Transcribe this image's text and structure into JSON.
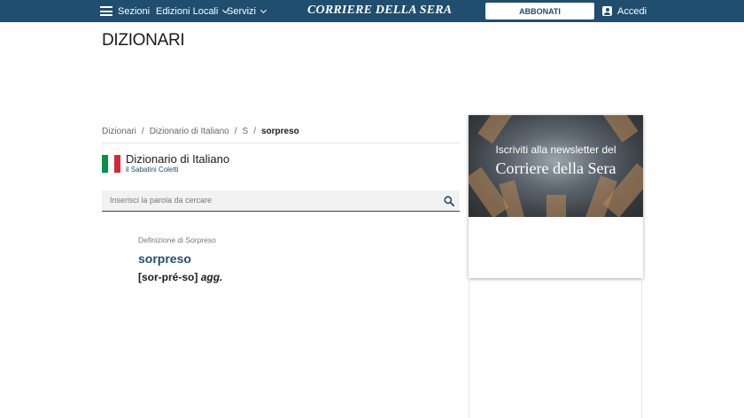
{
  "header": {
    "menu_label": "Sezioni",
    "edizioni_label": "Edizioni Locali",
    "servizi_label": "Servizi",
    "logo_text": "CORRIERE DELLA SERA",
    "abbonati_label": "ABBONATI",
    "accedi_label": "Accedi",
    "bg_color": "#1f4e6e"
  },
  "page": {
    "title": "DIZIONARI"
  },
  "breadcrumb": {
    "items": [
      "Dizionari",
      "Dizionario di Italiano",
      "S"
    ],
    "current": "sorpreso",
    "separator": "/"
  },
  "dictionary": {
    "title": "Dizionario di Italiano",
    "subtitle": "il Sabatini Coletti",
    "flag_colors": [
      "#009246",
      "#ffffff",
      "#ce2b37"
    ]
  },
  "search": {
    "placeholder": "Inserisci la parola da cercare",
    "value": ""
  },
  "definition": {
    "label": "Definizione di Sorpreso",
    "word": "sorpreso",
    "pronunciation": "[sor-pré-so]",
    "grammar": "agg."
  },
  "ad": {
    "line1": "Iscriviti alla newsletter del",
    "line2": "Corriere della Sera"
  }
}
